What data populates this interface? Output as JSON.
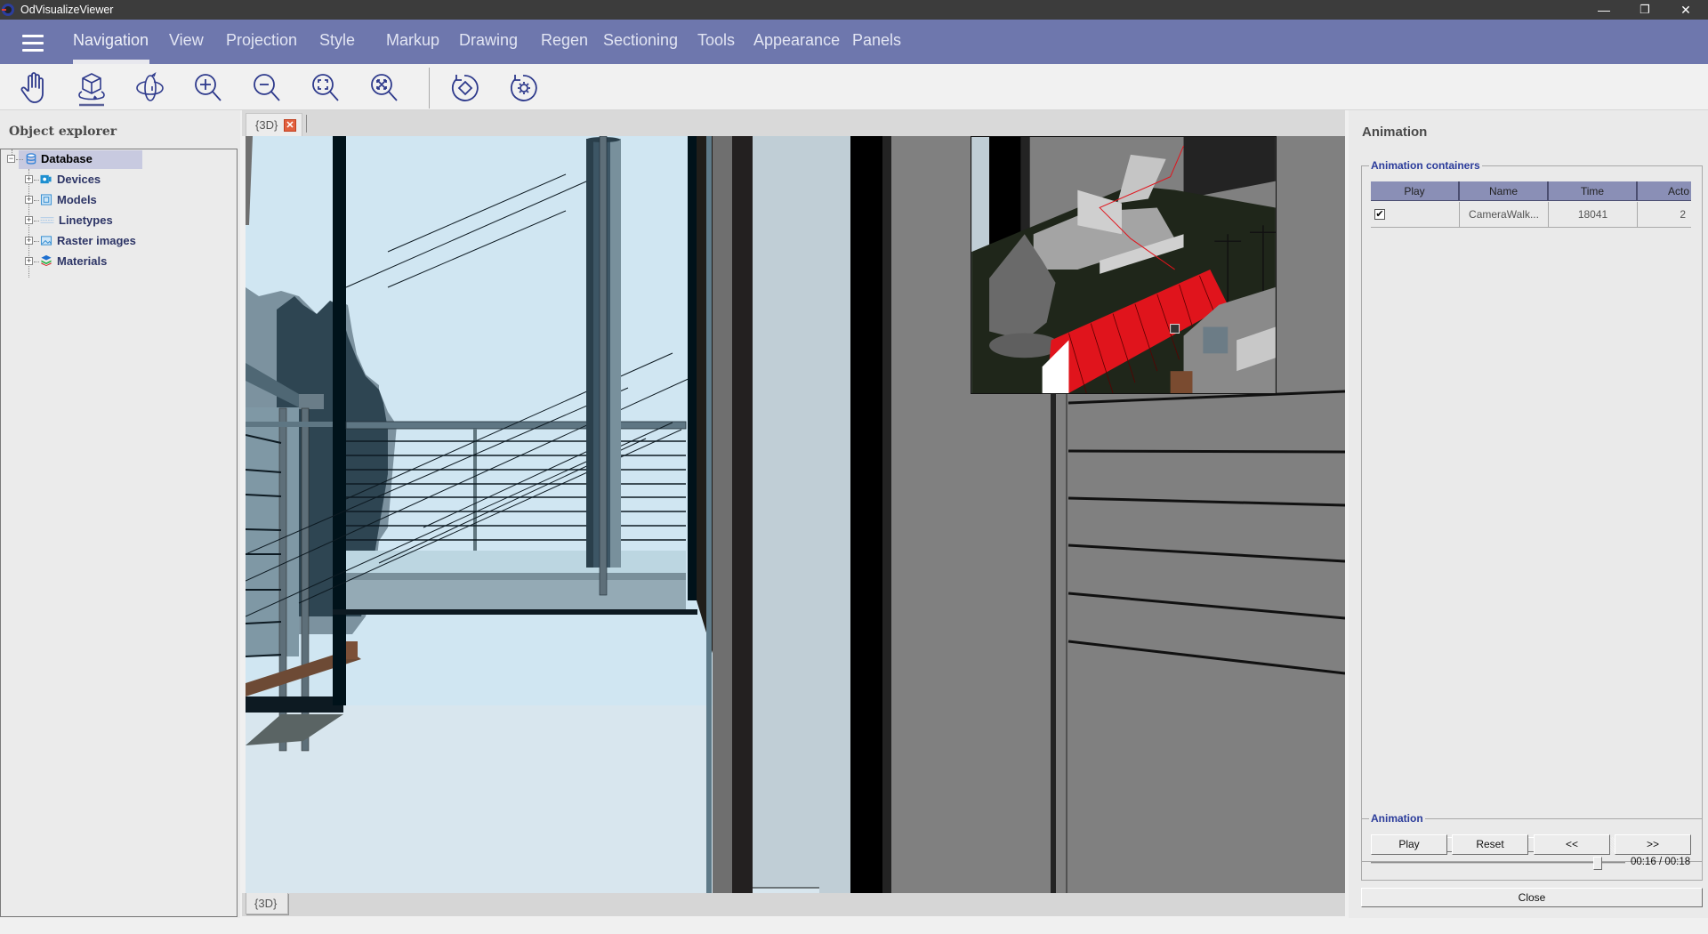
{
  "window": {
    "title": "OdVisualizeViewer",
    "controls": {
      "minimize": "—",
      "restore": "❐",
      "close": "✕"
    }
  },
  "menubar": {
    "items": [
      "Navigation",
      "View",
      "Projection",
      "Style",
      "Markup",
      "Drawing",
      "Regen",
      "Sectioning",
      "Tools",
      "Appearance",
      "Panels"
    ],
    "active": "Navigation"
  },
  "toolbar": {
    "tools": [
      {
        "name": "pan",
        "icon": "hand-icon"
      },
      {
        "name": "orbit",
        "icon": "orbit-cube-icon",
        "active": true
      },
      {
        "name": "turntable",
        "icon": "turntable-icon"
      },
      {
        "name": "zoom-in",
        "icon": "zoom-in-icon"
      },
      {
        "name": "zoom-out",
        "icon": "zoom-out-icon"
      },
      {
        "name": "zoom-window",
        "icon": "zoom-window-icon"
      },
      {
        "name": "zoom-extents",
        "icon": "zoom-extents-icon"
      },
      {
        "name": "reset-view",
        "icon": "reset-view-icon"
      },
      {
        "name": "reset-settings",
        "icon": "reset-settings-icon"
      }
    ]
  },
  "object_explorer": {
    "title": "Object explorer",
    "root": "Database",
    "children": [
      "Devices",
      "Models",
      "Linetypes",
      "Raster images",
      "Materials"
    ]
  },
  "viewport": {
    "top_tab": "{3D}",
    "bottom_tab": "{3D}"
  },
  "animation_panel": {
    "title": "Animation",
    "containers_group": "Animation containers",
    "columns": [
      "Play",
      "Name",
      "Time",
      "Acto"
    ],
    "rows": [
      {
        "play": true,
        "name": "CameraWalk...",
        "time": "18041",
        "actors": "2"
      }
    ],
    "controls_group": "Animation",
    "buttons": [
      "Play",
      "Reset",
      "<<",
      ">>"
    ],
    "progress": 0.89,
    "time_readout": "00:16 / 00:18",
    "close_label": "Close"
  },
  "colors": {
    "menubar": "#6e77ad",
    "titlebar": "#3c3c3c",
    "icon_blue": "#2e3a8c",
    "group_title": "#2a3b9a",
    "roof_red": "#e0141c"
  }
}
